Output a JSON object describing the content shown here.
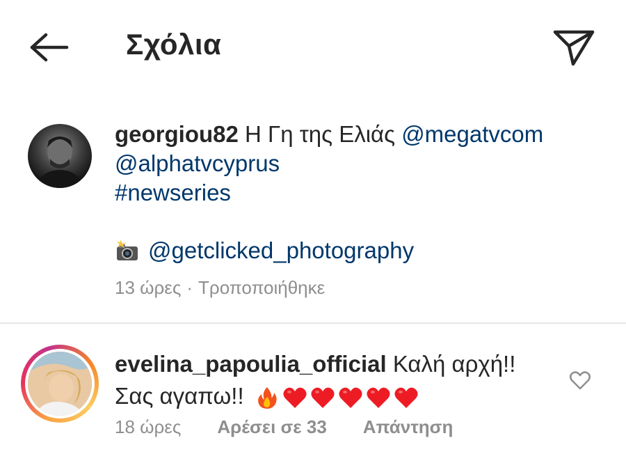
{
  "header": {
    "title": "Σχόλια",
    "back_icon": "arrow-left-icon",
    "share_icon": "send-icon"
  },
  "post": {
    "username": "georgiou82",
    "text": "Η Γη της Ελιάς",
    "mention_1": "@megatvcom",
    "mention_2": "@alphatvcyprus",
    "hashtag": "#newseries",
    "photo_credit": "@getclicked_photography",
    "time": "13 ώρες",
    "separator": "·",
    "edited": "Τροποποιήθηκε"
  },
  "comment": {
    "username": "evelina_papoulia_official",
    "text_line1": "Καλή αρχή!!",
    "text_line2": "Σας αγαπω!!",
    "emojis": [
      "fire-emoji",
      "heart-emoji",
      "heart-emoji",
      "heart-emoji",
      "heart-emoji",
      "heart-emoji"
    ],
    "time": "18 ώρες",
    "likes": "Αρέσει σε 33",
    "reply": "Απάντηση"
  },
  "colors": {
    "text": "#262626",
    "link": "#00376b",
    "meta": "#8e8e8e",
    "heart": "#ed1c24",
    "divider": "#e6e6e6"
  }
}
